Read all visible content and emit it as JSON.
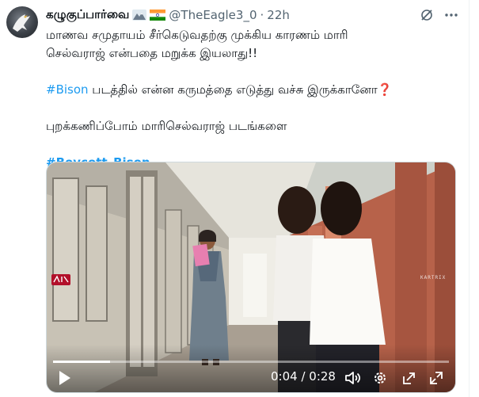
{
  "tweet": {
    "author_name": "கழுகுப்பார்வை",
    "handle": "@TheEagle3_0",
    "separator": "·",
    "time": "22h",
    "line1": "மாணவ சமுதாயம் சீர்கெடுவதற்கு முக்கிய காரணம் மாரி",
    "line2": "செல்வராஜ் என்பதை மறுக்க இயலாது!!",
    "hashtag_bison": "#Bison",
    "line3_rest": " படத்தில் என்ன கருமத்தை எடுத்து வச்சு இருக்கானோ",
    "question_mark": "❓",
    "line4": "புறக்கணிப்போம் மாரிசெல்வராஜ் படங்களை",
    "hashtag_boycott": "#Boycott_Bison"
  },
  "video": {
    "current_time": "0:04",
    "time_separator": " / ",
    "duration": "0:28",
    "progress_fraction": 0.143,
    "watermark_right": "KARTRIX"
  },
  "icons": {
    "avatar": "eagle-avatar",
    "badges": [
      "mountain-emoji",
      "india-flag-emoji"
    ],
    "grok": "grok-icon",
    "more": "more-icon",
    "play": "play-icon",
    "volume": "volume-icon",
    "settings": "gear-icon",
    "popout": "popout-icon",
    "fullscreen": "fullscreen-icon"
  },
  "colors": {
    "link": "#1d9bf0",
    "text": "#0f1419",
    "muted": "#536471"
  }
}
